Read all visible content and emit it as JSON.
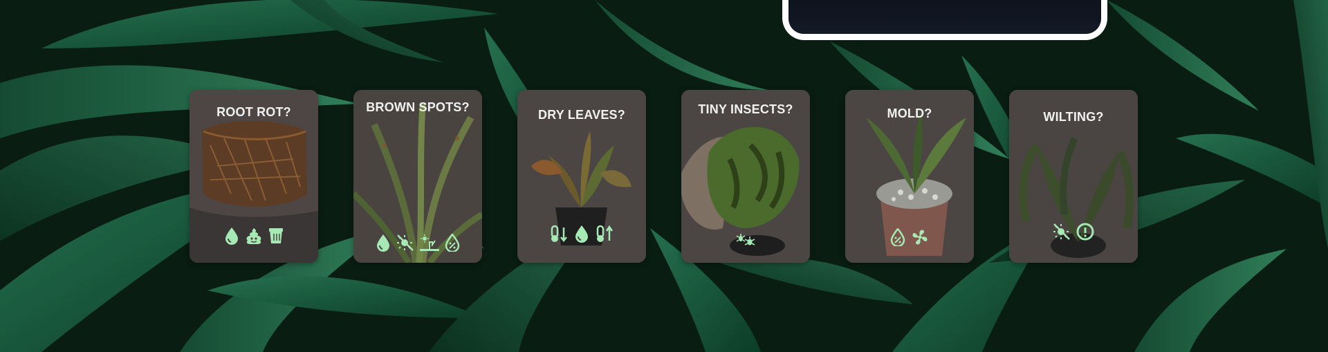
{
  "colors": {
    "accent_icon": "#a6e9b4",
    "card_bg": "#48423f",
    "title_text": "#f1f1f1",
    "leaf_dark": "#0c2a1c",
    "leaf_mid": "#1f6b48",
    "leaf_light": "#3f9a70"
  },
  "cards": [
    {
      "title": "ROOT ROT?",
      "icons": [
        "water-drop-icon",
        "poop-icon",
        "pot-wet-icon"
      ]
    },
    {
      "title": "BROWN SPOTS?",
      "icons": [
        "water-drop-icon",
        "no-sun-icon",
        "fertilizer-icon",
        "drop-percent-icon"
      ]
    },
    {
      "title": "DRY LEAVES?",
      "icons": [
        "thermometer-down-icon",
        "water-drop-icon",
        "thermometer-up-icon"
      ]
    },
    {
      "title": "TINY INSECTS?",
      "icons": [
        "bugs-icon"
      ]
    },
    {
      "title": "MOLD?",
      "icons": [
        "drop-percent-icon",
        "fan-icon"
      ]
    },
    {
      "title": "WILTING?",
      "icons": [
        "no-sun-icon",
        "alert-icon"
      ]
    }
  ]
}
